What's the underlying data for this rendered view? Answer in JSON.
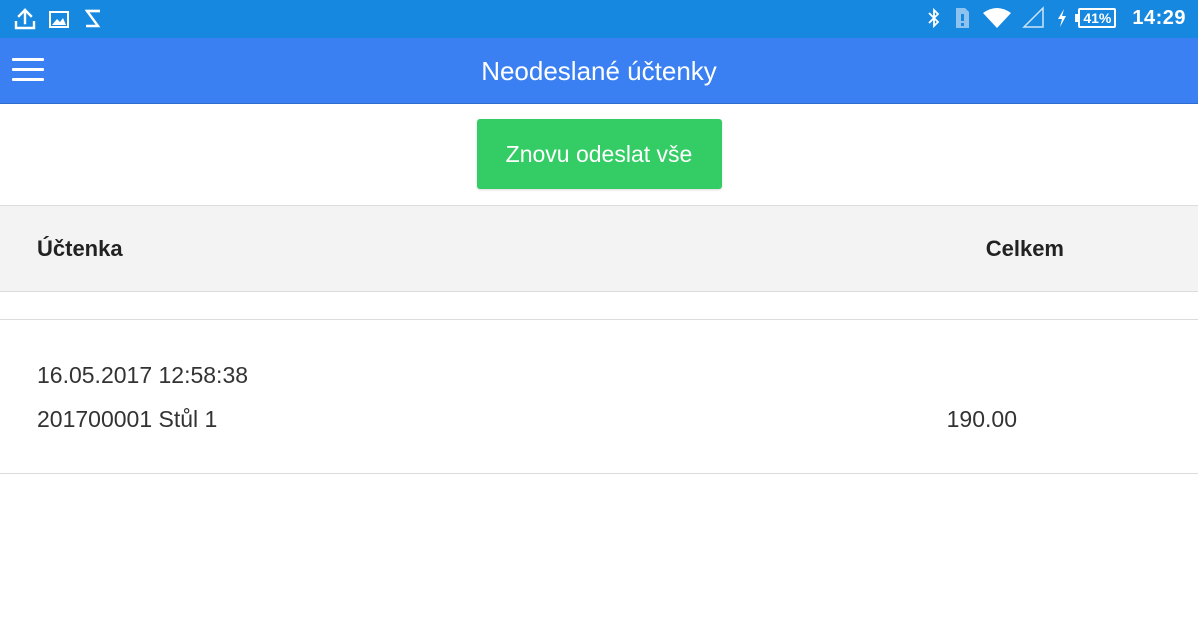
{
  "status_bar": {
    "icons_left": [
      "upload-icon",
      "image-icon",
      "s-logo-icon"
    ],
    "icons_right": [
      "bluetooth-icon",
      "sim-icon",
      "wifi-icon",
      "signal-icon",
      "charging-icon"
    ],
    "battery": "41%",
    "time": "14:29"
  },
  "app_bar": {
    "title": "Neodeslané účtenky",
    "menu_icon": "hamburger-icon"
  },
  "actions": {
    "resend_all": "Znovu odeslat vše"
  },
  "table": {
    "headers": {
      "receipt": "Účtenka",
      "total": "Celkem"
    },
    "rows": [
      {
        "date": "16.05.2017 12:58:38",
        "name": "201700001 Stůl 1",
        "total": "190.00"
      }
    ]
  },
  "colors": {
    "status_bar": "#1788df",
    "app_bar": "#3a80f2",
    "button": "#34cc64",
    "header_bg": "#f3f3f3"
  }
}
